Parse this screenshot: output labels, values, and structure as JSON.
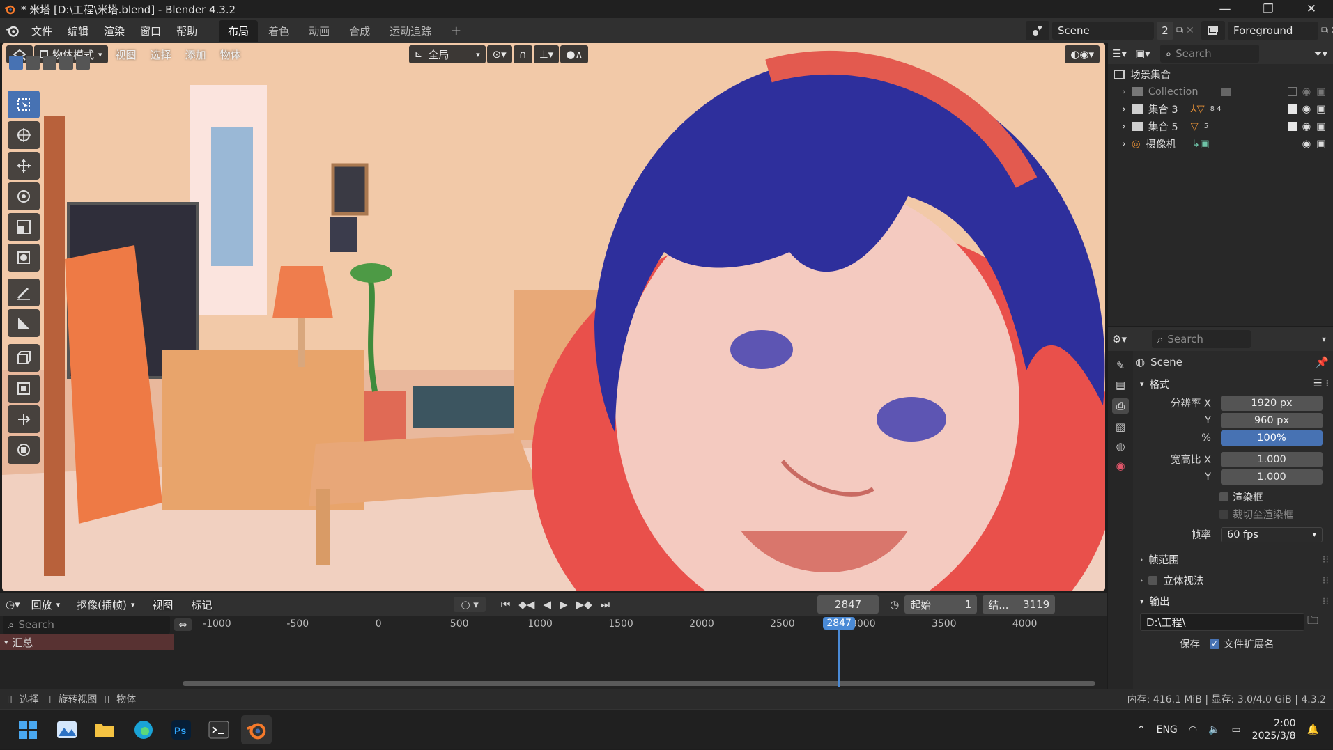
{
  "window": {
    "title": "* 米塔 [D:\\工程\\米塔.blend] - Blender 4.3.2",
    "minimize": "—",
    "maximize": "❐",
    "close": "✕"
  },
  "menu": {
    "items": [
      "文件",
      "编辑",
      "渲染",
      "窗口",
      "帮助"
    ],
    "workspaces": [
      "布局",
      "着色",
      "动画",
      "合成",
      "运动追踪"
    ],
    "active_workspace": "布局",
    "add": "+",
    "scene_name": "Scene",
    "scene_users": "2",
    "view_layer": "Foreground"
  },
  "viewport": {
    "mode": "物体模式",
    "menus": [
      "视图",
      "选择",
      "添加",
      "物体"
    ],
    "orientation": "全局"
  },
  "outliner": {
    "search_placeholder": "Search",
    "root": "场景集合",
    "items": [
      {
        "name": "Collection",
        "badge": ""
      },
      {
        "name": "集合 3",
        "badge": "8 4"
      },
      {
        "name": "集合 5",
        "badge": "5"
      },
      {
        "name": "摄像机",
        "badge": ""
      }
    ]
  },
  "properties": {
    "search_placeholder": "Search",
    "scene": "Scene",
    "section_format": "格式",
    "res_x_label": "分辨率 X",
    "res_x": "1920 px",
    "res_y_label": "Y",
    "res_y": "960 px",
    "pct_label": "%",
    "pct": "100%",
    "aspect_x_label": "宽高比 X",
    "aspect_x": "1.000",
    "aspect_y_label": "Y",
    "aspect_y": "1.000",
    "render_region": "渲染框",
    "crop_region": "裁切至渲染框",
    "fps_label": "帧率",
    "fps": "60 fps",
    "section_frame_range": "帧范围",
    "section_stereo": "立体视法",
    "section_output": "输出",
    "output_path": "D:\\工程\\",
    "save_label": "保存",
    "file_ext": "文件扩展名"
  },
  "timeline": {
    "playback": "回放",
    "keying": "抠像(插帧)",
    "view": "视图",
    "marker": "标记",
    "current_frame": "2847",
    "start_label": "起始",
    "start": "1",
    "end_label": "结...",
    "end": "3119",
    "search_placeholder": "Search",
    "summary": "汇总",
    "ticks": [
      "-1000",
      "-500",
      "0",
      "500",
      "1000",
      "1500",
      "2000",
      "2500",
      "3000",
      "3500",
      "4000"
    ],
    "playhead_label": "2847"
  },
  "status": {
    "select": "选择",
    "rotate": "旋转视图",
    "object": "物体",
    "info": "内存: 416.1 MiB | 显存: 3.0/4.0 GiB | 4.3.2"
  },
  "taskbar": {
    "lang": "ENG",
    "time": "2:00",
    "date": "2025/3/8"
  }
}
